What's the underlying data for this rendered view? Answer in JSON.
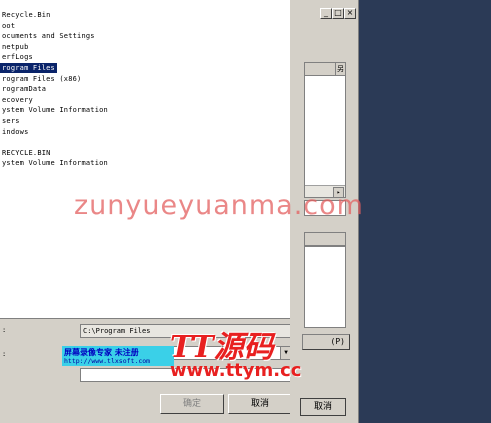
{
  "tree": {
    "items": [
      {
        "label": "Recycle.Bin",
        "selected": false
      },
      {
        "label": "oot",
        "selected": false
      },
      {
        "label": "ocuments and Settings",
        "selected": false
      },
      {
        "label": "netpub",
        "selected": false
      },
      {
        "label": "erfLogs",
        "selected": false
      },
      {
        "label": "rogram Files",
        "selected": true
      },
      {
        "label": "rogram Files (x86)",
        "selected": false
      },
      {
        "label": "rogramData",
        "selected": false
      },
      {
        "label": "ecovery",
        "selected": false
      },
      {
        "label": "ystem Volume Information",
        "selected": false
      },
      {
        "label": "sers",
        "selected": false
      },
      {
        "label": "indows",
        "selected": false
      },
      {
        "label": "",
        "selected": false
      },
      {
        "label": "RECYCLE.BIN",
        "selected": false
      },
      {
        "label": "ystem Volume Information",
        "selected": false
      }
    ]
  },
  "path_field": {
    "label": ":",
    "value": "C:\\Program Files"
  },
  "combo": {
    "label": ":"
  },
  "buttons": {
    "ok": "确定",
    "cancel": "取消"
  },
  "bg_window": {
    "minimize": "_",
    "maximize": "□",
    "close": "×",
    "col_header": "另",
    "scroll_arrow": "▸",
    "browse_label": "(P)",
    "cancel": "取消"
  },
  "recorder_banner": {
    "title": "屏幕录像专家 未注册",
    "url": "http://www.tlxsoft.com"
  },
  "watermark": {
    "text": "zunyueyuanma.com"
  },
  "logo": {
    "main": "TT源码",
    "url": "www.ttym.cc"
  },
  "colors": {
    "desktop": "#2b3a56",
    "selection": "#0a246a",
    "window_face": "#d4d0c8",
    "watermark_red": "#e82020",
    "banner_cyan": "#3ad0e8"
  }
}
